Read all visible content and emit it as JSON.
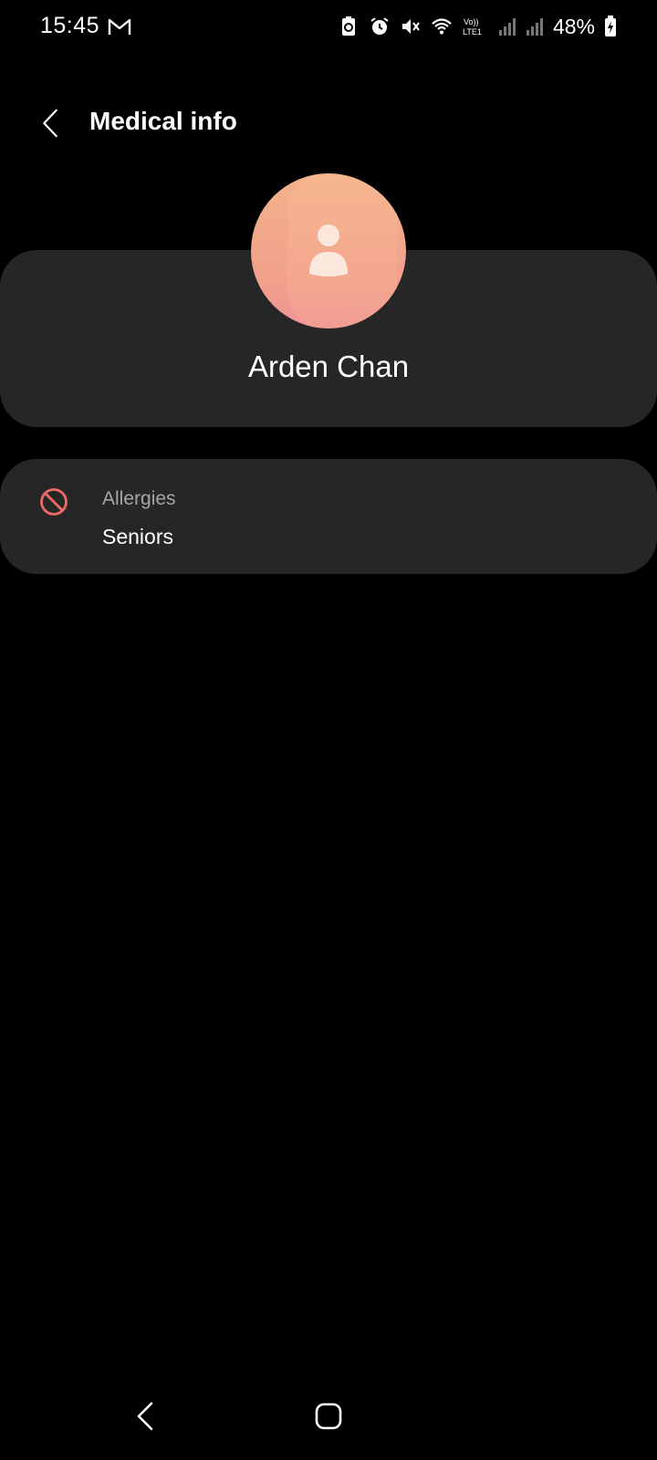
{
  "status_bar": {
    "time": "15:45",
    "battery_percent": "48%",
    "icons": [
      "gmail-icon",
      "battery-saver-icon",
      "alarm-icon",
      "mute-icon",
      "wifi-icon",
      "volte-lte-icon",
      "signal-icon",
      "signal-icon-2",
      "battery-charging-icon"
    ]
  },
  "app_bar": {
    "title": "Medical info"
  },
  "profile": {
    "name": "Arden Chan"
  },
  "allergies": {
    "label": "Allergies",
    "value": "Seniors",
    "icon": "no-entry-icon",
    "icon_color": "#f06b66"
  },
  "colors": {
    "background": "#000000",
    "card": "#262626",
    "avatar_top": "#f3b28a",
    "avatar_bottom": "#ee9393"
  }
}
